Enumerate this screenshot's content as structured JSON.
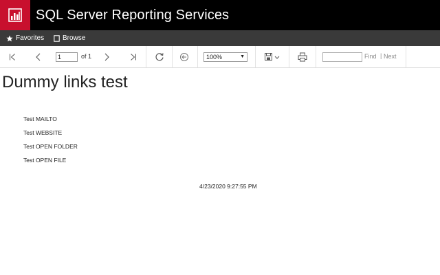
{
  "header": {
    "app_title": "SQL Server Reporting Services",
    "brand_color": "#c8102e",
    "logo_icon": "report-chart-icon"
  },
  "nav": {
    "favorites_label": "Favorites",
    "favorites_icon": "star-icon",
    "browse_label": "Browse",
    "browse_icon": "document-icon"
  },
  "toolbar": {
    "first_page_icon": "first-page-icon",
    "prev_page_icon": "chevron-left-icon",
    "page_value": "1",
    "of_label": "of 1",
    "next_page_icon": "chevron-right-icon",
    "last_page_icon": "last-page-icon",
    "refresh_icon": "refresh-icon",
    "back_icon": "back-circle-icon",
    "zoom_value": "100%",
    "export_icon": "save-icon",
    "print_icon": "print-icon",
    "find_value": "",
    "find_label": "Find",
    "find_separator": "|",
    "next_label": "Next"
  },
  "report": {
    "title": "Dummy links test",
    "links": [
      "Test MAILTO",
      "Test WEBSITE",
      "Test OPEN FOLDER",
      "Test OPEN FILE"
    ],
    "timestamp": "4/23/2020 9:27:55 PM"
  }
}
